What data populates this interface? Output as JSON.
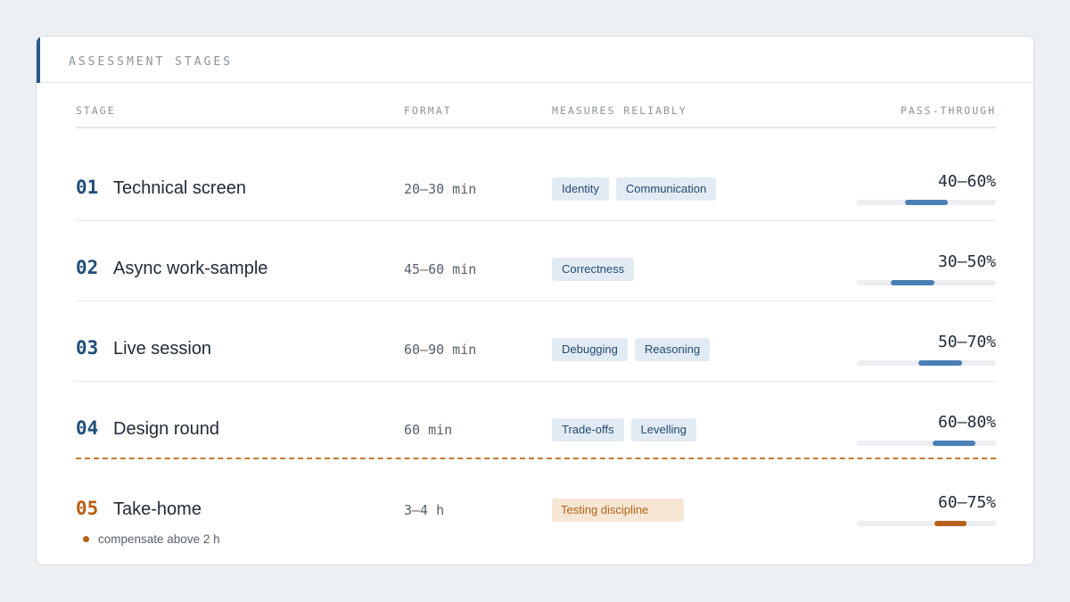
{
  "card": {
    "title": "ASSESSMENT STAGES",
    "accent_color": "#2b5a8a"
  },
  "columns": {
    "stage": "STAGE",
    "format": "FORMAT",
    "measures": "MEASURES RELIABLY",
    "pass_through": "PASS-THROUGH"
  },
  "stages": [
    {
      "num": "01",
      "name": "Technical screen",
      "format": "20–30 min",
      "tags": [
        "Identity",
        "Communication"
      ],
      "pass": "40–60%",
      "range": [
        40,
        60
      ]
    },
    {
      "num": "02",
      "name": "Async work-sample",
      "format": "45–60 min",
      "tags": [
        "Correctness"
      ],
      "pass": "30–50%",
      "range": [
        30,
        50
      ]
    },
    {
      "num": "03",
      "name": "Live session",
      "format": "60–90 min",
      "tags": [
        "Debugging",
        "Reasoning"
      ],
      "pass": "50–70%",
      "range": [
        50,
        70
      ]
    },
    {
      "num": "04",
      "name": "Design round",
      "format": "60 min",
      "tags": [
        "Trade-offs",
        "Levelling"
      ],
      "pass": "60–80%",
      "range": [
        60,
        80
      ]
    },
    {
      "num": "05",
      "name": "Take-home",
      "format": "3–4 h",
      "tags": [
        "Testing discipline"
      ],
      "pass": "60–75%",
      "range": [
        60,
        75
      ]
    }
  ],
  "note": "compensate above 2 h",
  "colors": {
    "stage_accent": "#1f4e79",
    "bar_fill": "#4a7fb5",
    "warning": "#b5611a",
    "warning_tag_bg": "#f6e6d3"
  }
}
